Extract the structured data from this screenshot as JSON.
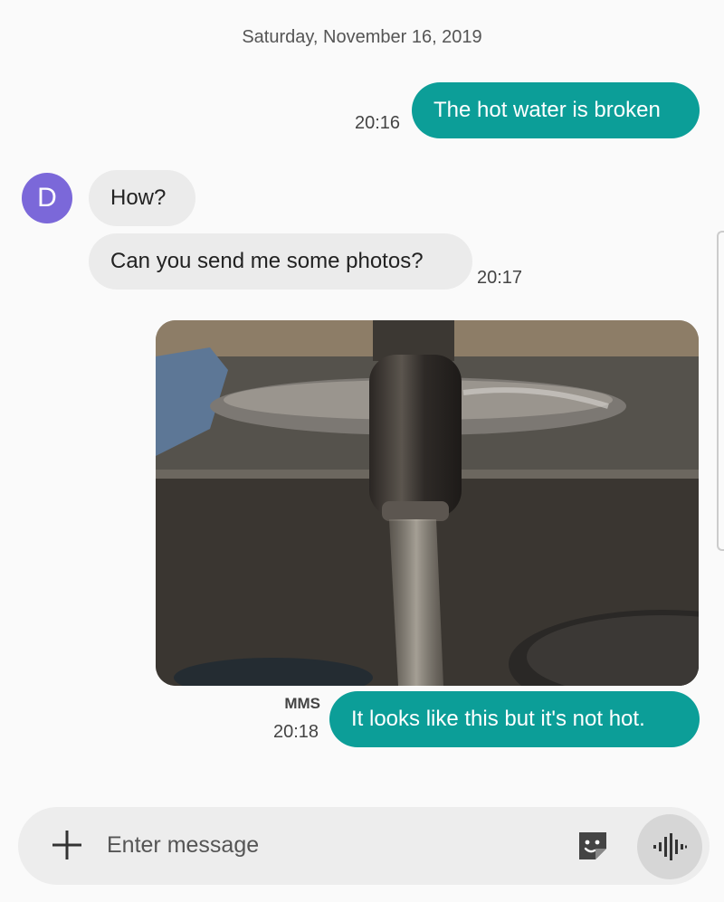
{
  "date_header": "Saturday, November 16, 2019",
  "messages": [
    {
      "direction": "outgoing",
      "text": "The hot water is broken",
      "time": "20:16"
    },
    {
      "direction": "incoming",
      "text": "How?"
    },
    {
      "direction": "incoming",
      "text": "Can you send me some photos?",
      "time": "20:17"
    },
    {
      "direction": "outgoing",
      "type": "image",
      "label": "MMS",
      "text": "It looks like this but it's not hot.",
      "time": "20:18"
    }
  ],
  "contact": {
    "initial": "D",
    "avatar_color": "#7b68d9"
  },
  "composer": {
    "placeholder": "Enter message"
  },
  "icons": {
    "add": "plus-icon",
    "sticker": "sticker-icon",
    "voice": "voice-waveform-icon"
  },
  "colors": {
    "outgoing_bubble": "#0c9e98",
    "incoming_bubble": "#ebebeb"
  }
}
